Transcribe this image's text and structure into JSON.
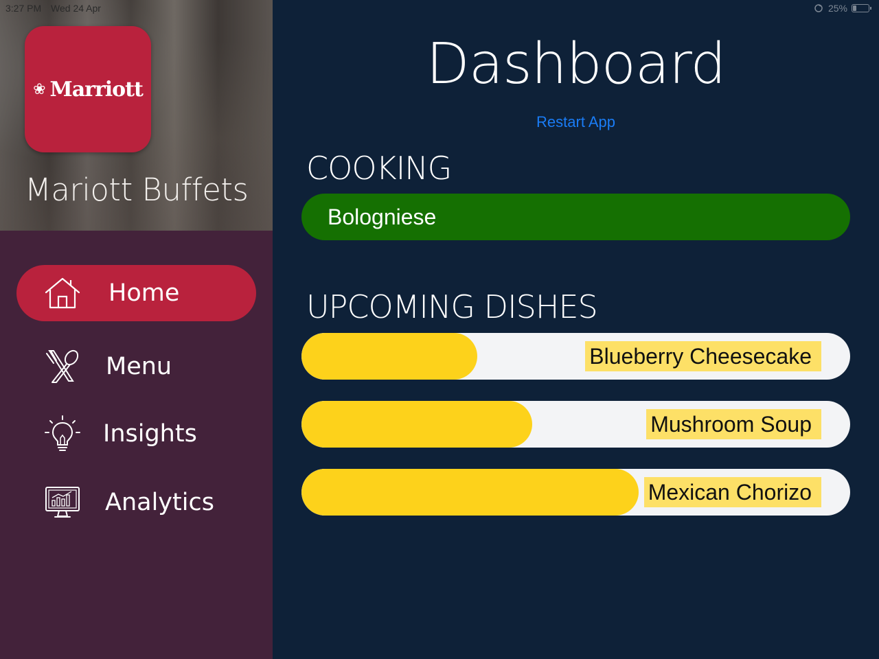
{
  "status_bar": {
    "time": "3:27 PM",
    "date": "Wed 24 Apr",
    "battery": "25%",
    "battery_level": 0.25
  },
  "sidebar": {
    "logo_text": "Marriott",
    "brand_name": "Mariott Buffets",
    "items": [
      {
        "label": "Home",
        "icon": "home-icon",
        "active": true
      },
      {
        "label": "Menu",
        "icon": "utensils-icon",
        "active": false
      },
      {
        "label": "Insights",
        "icon": "lightbulb-icon",
        "active": false
      },
      {
        "label": "Analytics",
        "icon": "analytics-monitor-icon",
        "active": false
      }
    ]
  },
  "main": {
    "title": "Dashboard",
    "restart_label": "Restart App",
    "cooking": {
      "heading": "COOKING",
      "dish": "Bologniese"
    },
    "upcoming": {
      "heading": "UPCOMING DISHES",
      "dishes": [
        {
          "name": "Blueberry Cheesecake",
          "progress": 0.32
        },
        {
          "name": "Mushroom Soup",
          "progress": 0.42
        },
        {
          "name": "Mexican Chorizo",
          "progress": 0.615
        }
      ]
    }
  },
  "colors": {
    "sidebar_bg": "#43223a",
    "active_item": "#b9223d",
    "main_bg": "#0e2138",
    "cooking_bar": "#157002",
    "progress_fill": "#fdd21b",
    "progress_track": "#f3f4f6",
    "link": "#1a7cf5"
  }
}
